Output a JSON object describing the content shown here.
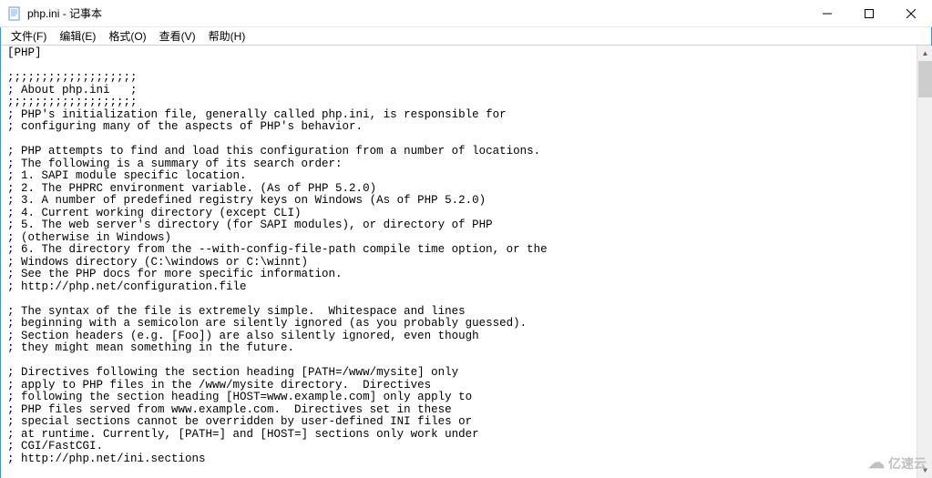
{
  "window": {
    "title": "php.ini - 记事本"
  },
  "menu": {
    "file": "文件(F)",
    "edit": "编辑(E)",
    "format": "格式(O)",
    "view": "查看(V)",
    "help": "帮助(H)"
  },
  "content": "[PHP]\n\n;;;;;;;;;;;;;;;;;;;\n; About php.ini   ;\n;;;;;;;;;;;;;;;;;;;\n; PHP's initialization file, generally called php.ini, is responsible for\n; configuring many of the aspects of PHP's behavior.\n\n; PHP attempts to find and load this configuration from a number of locations.\n; The following is a summary of its search order:\n; 1. SAPI module specific location.\n; 2. The PHPRC environment variable. (As of PHP 5.2.0)\n; 3. A number of predefined registry keys on Windows (As of PHP 5.2.0)\n; 4. Current working directory (except CLI)\n; 5. The web server's directory (for SAPI modules), or directory of PHP\n; (otherwise in Windows)\n; 6. The directory from the --with-config-file-path compile time option, or the\n; Windows directory (C:\\windows or C:\\winnt)\n; See the PHP docs for more specific information.\n; http://php.net/configuration.file\n\n; The syntax of the file is extremely simple.  Whitespace and lines\n; beginning with a semicolon are silently ignored (as you probably guessed).\n; Section headers (e.g. [Foo]) are also silently ignored, even though\n; they might mean something in the future.\n\n; Directives following the section heading [PATH=/www/mysite] only\n; apply to PHP files in the /www/mysite directory.  Directives\n; following the section heading [HOST=www.example.com] only apply to\n; PHP files served from www.example.com.  Directives set in these\n; special sections cannot be overridden by user-defined INI files or\n; at runtime. Currently, [PATH=] and [HOST=] sections only work under\n; CGI/FastCGI.\n; http://php.net/ini.sections",
  "watermark": "亿速云"
}
